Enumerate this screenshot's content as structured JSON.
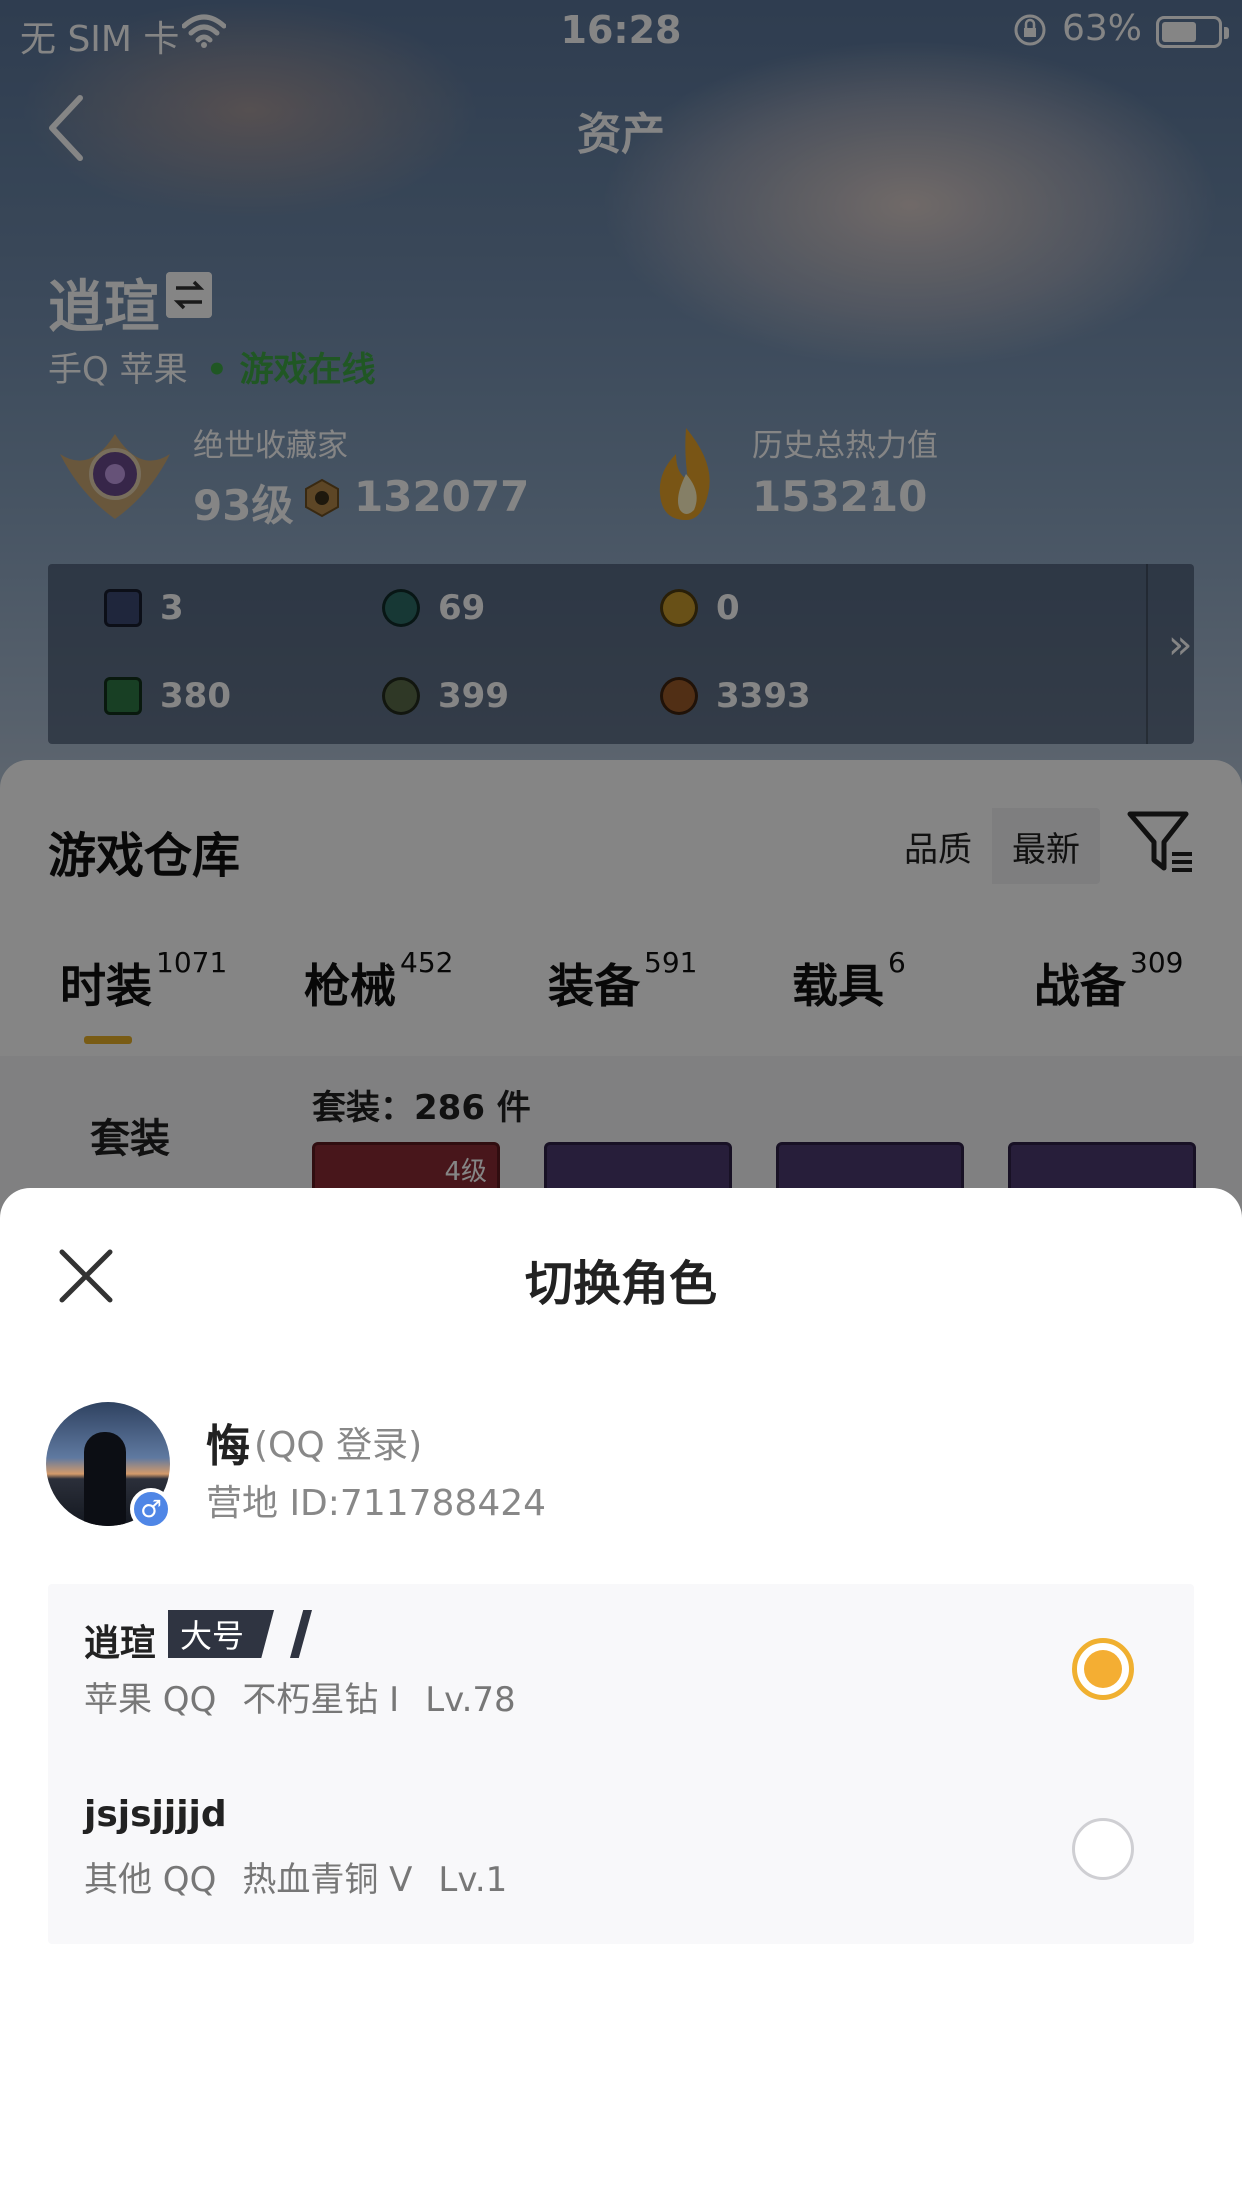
{
  "status_bar": {
    "carrier": "无 SIM 卡",
    "time": "16:28",
    "battery": "63%"
  },
  "nav": {
    "title": "资产"
  },
  "player": {
    "name": "逍瑄",
    "platform": "手Q 苹果",
    "status": "• 游戏在线",
    "collector_title": "绝世收藏家",
    "collector_level": "93级",
    "collector_points": "132077",
    "heat_title": "历史总热力值",
    "heat_value": "153210",
    "help": "?"
  },
  "resources": [
    {
      "value": "3",
      "color": "#3d4a73"
    },
    {
      "value": "69",
      "color": "#2c6b66"
    },
    {
      "value": "0",
      "color": "#c79a2c"
    },
    {
      "value": "380",
      "color": "#2f7a45"
    },
    {
      "value": "399",
      "color": "#5a6b4a"
    },
    {
      "value": "3393",
      "color": "#9c5a2a"
    }
  ],
  "resources_more": "»",
  "warehouse": {
    "title": "游戏仓库",
    "sort_quality": "品质",
    "sort_latest": "最新",
    "tabs": [
      {
        "label": "时装",
        "count": "1071"
      },
      {
        "label": "枪械",
        "count": "452"
      },
      {
        "label": "装备",
        "count": "591"
      },
      {
        "label": "载具",
        "count": "6"
      },
      {
        "label": "战备",
        "count": "309"
      }
    ],
    "side_item": "套装",
    "set_count": "套装：286 件",
    "thumb_level": "4级"
  },
  "sheet": {
    "title": "切换角色",
    "account": {
      "name": "悔",
      "login": "(QQ 登录)",
      "id": "营地 ID:711788424",
      "gender": "♂"
    },
    "roles": [
      {
        "name": "逍瑄",
        "tag": "大号",
        "platform": "苹果 QQ",
        "rank": "不朽星钻 I",
        "level": "Lv.78",
        "selected": true
      },
      {
        "name": "jsjsjjjjd",
        "tag": "",
        "platform": "其他 QQ",
        "rank": "热血青铜 V",
        "level": "Lv.1",
        "selected": false
      }
    ]
  },
  "colors": {
    "accent": "#f4ae33",
    "tag_bg": "#2f3441",
    "online": "#3ea845"
  }
}
